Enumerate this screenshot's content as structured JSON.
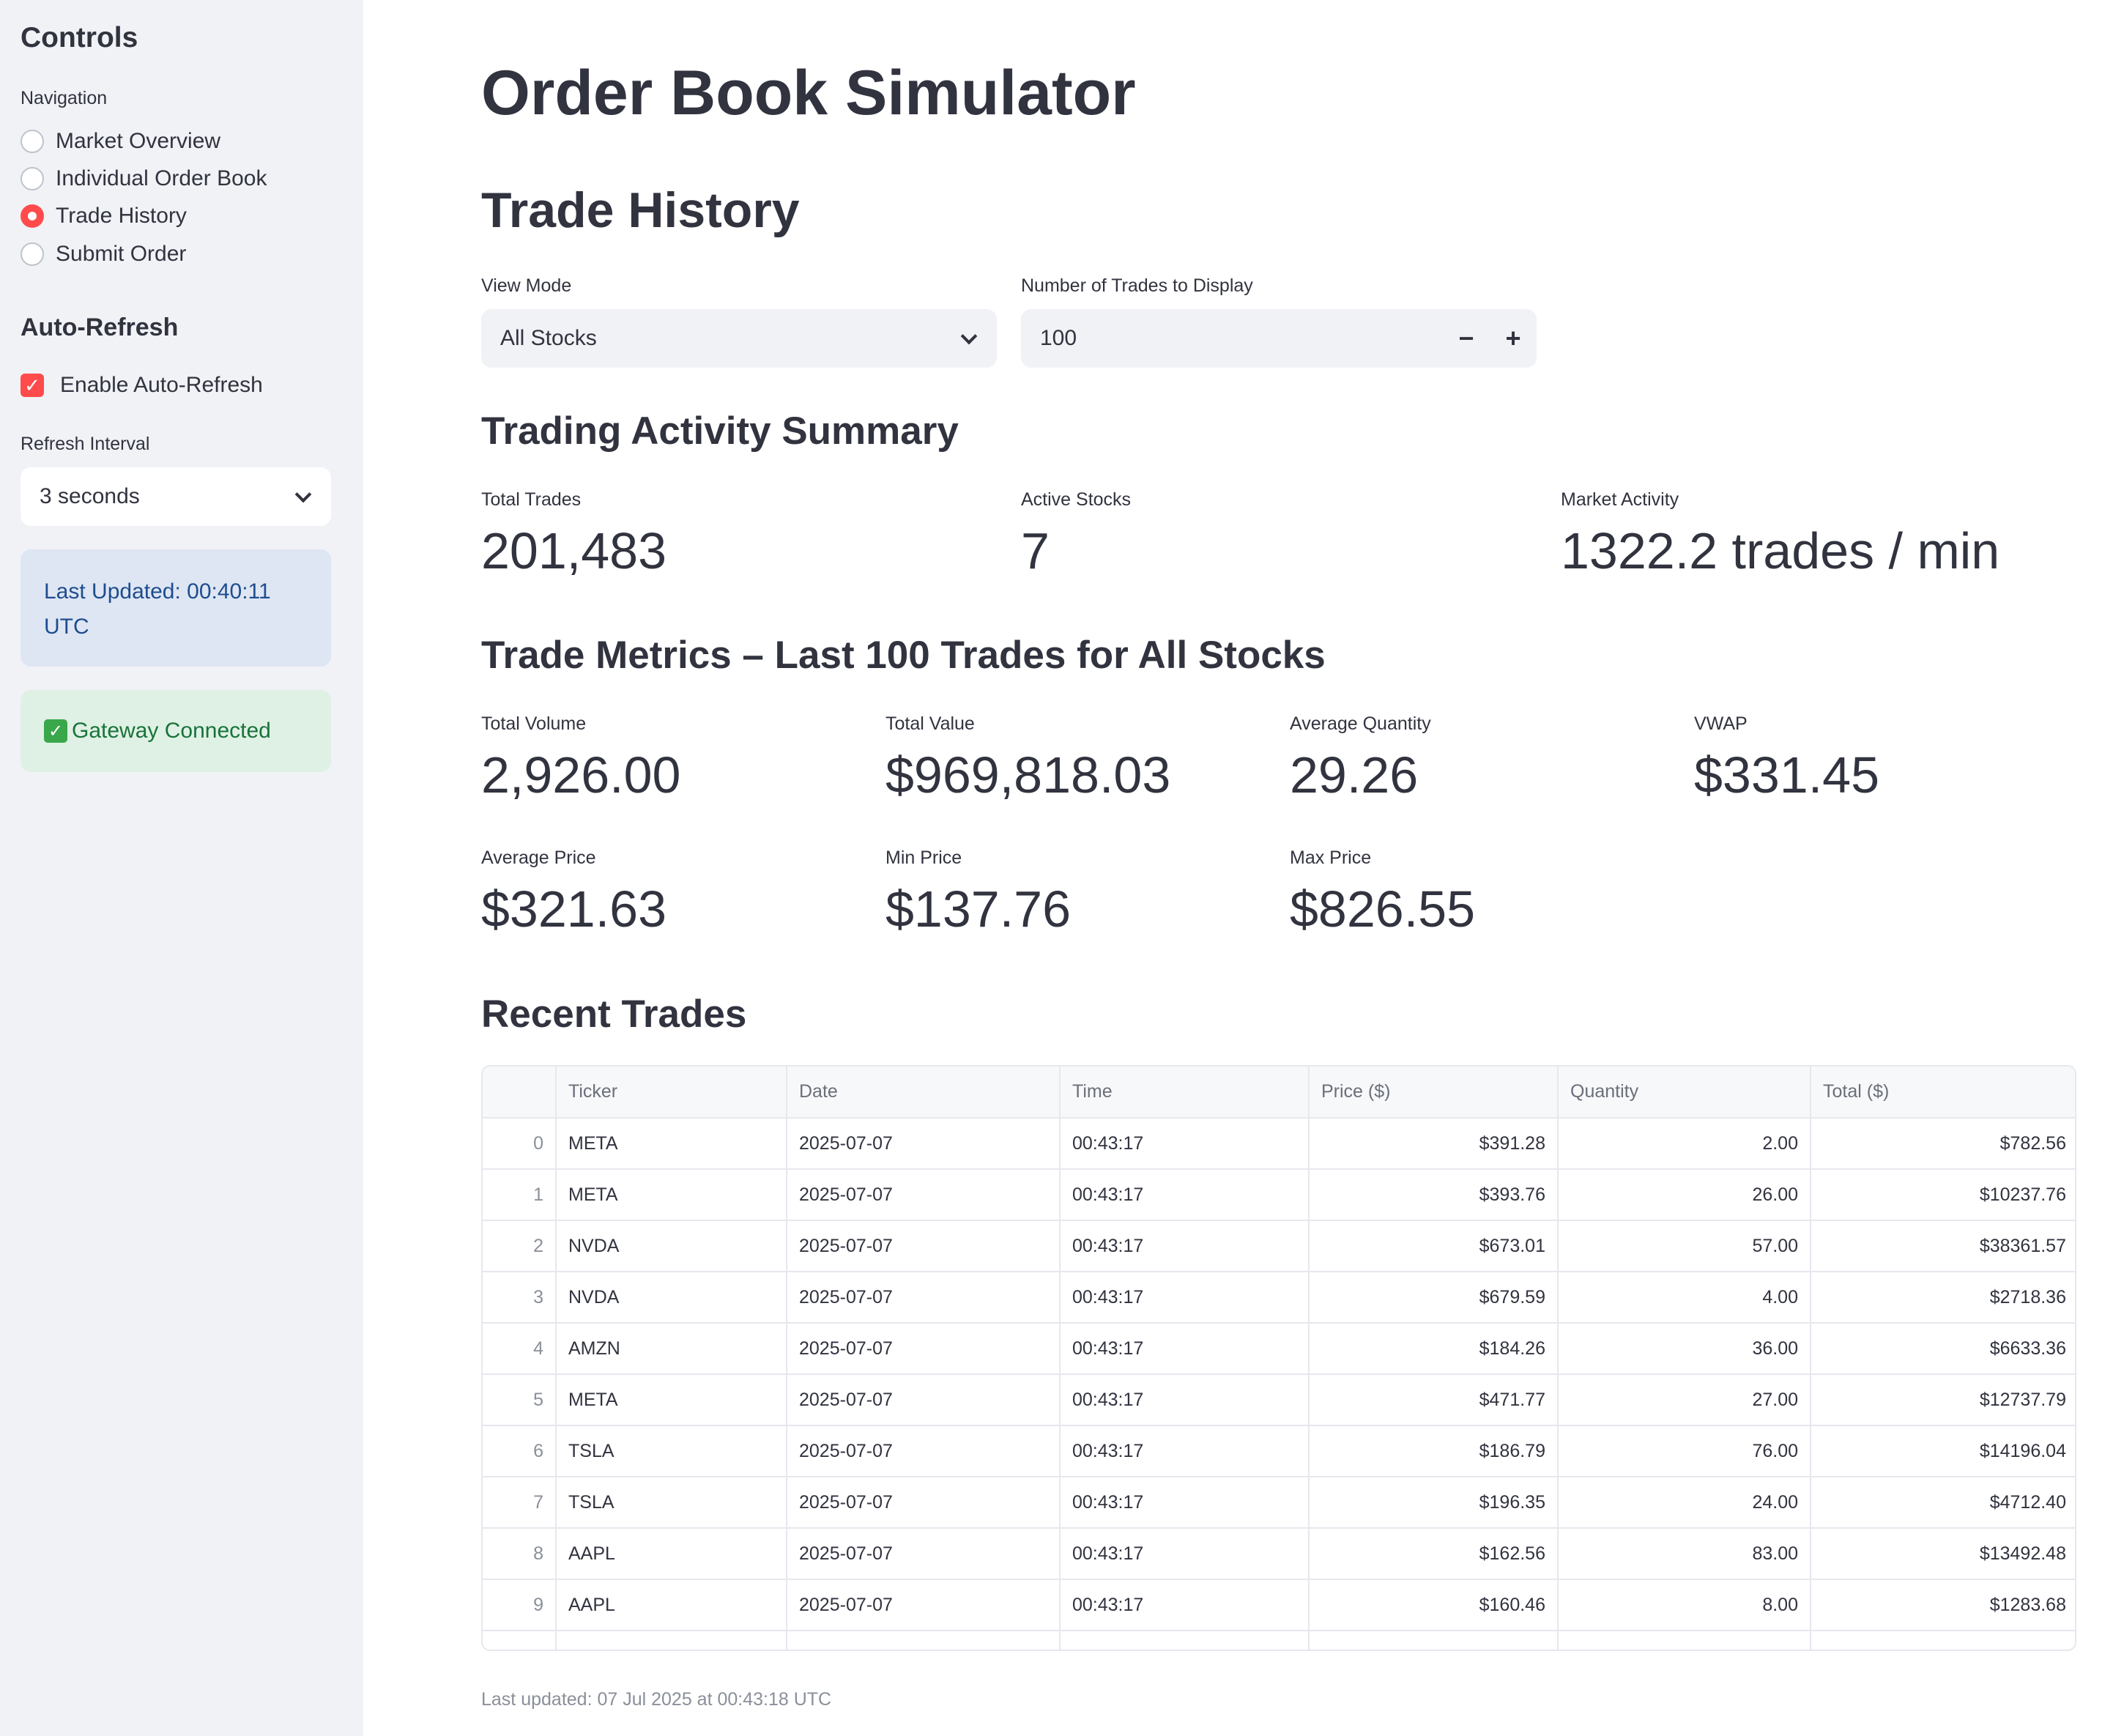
{
  "sidebar": {
    "title": "Controls",
    "navigation_label": "Navigation",
    "nav_items": [
      {
        "label": "Market Overview",
        "selected": false
      },
      {
        "label": "Individual Order Book",
        "selected": false
      },
      {
        "label": "Trade History",
        "selected": true
      },
      {
        "label": "Submit Order",
        "selected": false
      }
    ],
    "auto_refresh_heading": "Auto-Refresh",
    "enable_auto_refresh_label": "Enable Auto-Refresh",
    "enable_auto_refresh_checked": true,
    "refresh_interval_label": "Refresh Interval",
    "refresh_interval_value": "3 seconds",
    "last_updated_text": "Last Updated: 00:40:11 UTC",
    "gateway_status_text": "Gateway Connected"
  },
  "main": {
    "title": "Order Book Simulator",
    "section_title": "Trade History",
    "view_mode_label": "View Mode",
    "view_mode_value": "All Stocks",
    "num_trades_label": "Number of Trades to Display",
    "num_trades_value": "100",
    "summary_heading": "Trading Activity Summary",
    "summary_metrics": [
      {
        "label": "Total Trades",
        "value": "201,483"
      },
      {
        "label": "Active Stocks",
        "value": "7"
      },
      {
        "label": "Market Activity",
        "value": "1322.2 trades / min"
      }
    ],
    "metrics_heading": "Trade Metrics – Last 100 Trades for All Stocks",
    "trade_metrics": [
      {
        "label": "Total Volume",
        "value": "2,926.00"
      },
      {
        "label": "Total Value",
        "value": "$969,818.03"
      },
      {
        "label": "Average Quantity",
        "value": "29.26"
      },
      {
        "label": "VWAP",
        "value": "$331.45"
      },
      {
        "label": "Average Price",
        "value": "$321.63"
      },
      {
        "label": "Min Price",
        "value": "$137.76"
      },
      {
        "label": "Max Price",
        "value": "$826.55"
      }
    ],
    "recent_trades_heading": "Recent Trades",
    "table": {
      "columns": [
        "",
        "Ticker",
        "Date",
        "Time",
        "Price ($)",
        "Quantity",
        "Total ($)"
      ],
      "rows": [
        [
          "0",
          "META",
          "2025-07-07",
          "00:43:17",
          "$391.28",
          "2.00",
          "$782.56"
        ],
        [
          "1",
          "META",
          "2025-07-07",
          "00:43:17",
          "$393.76",
          "26.00",
          "$10237.76"
        ],
        [
          "2",
          "NVDA",
          "2025-07-07",
          "00:43:17",
          "$673.01",
          "57.00",
          "$38361.57"
        ],
        [
          "3",
          "NVDA",
          "2025-07-07",
          "00:43:17",
          "$679.59",
          "4.00",
          "$2718.36"
        ],
        [
          "4",
          "AMZN",
          "2025-07-07",
          "00:43:17",
          "$184.26",
          "36.00",
          "$6633.36"
        ],
        [
          "5",
          "META",
          "2025-07-07",
          "00:43:17",
          "$471.77",
          "27.00",
          "$12737.79"
        ],
        [
          "6",
          "TSLA",
          "2025-07-07",
          "00:43:17",
          "$186.79",
          "76.00",
          "$14196.04"
        ],
        [
          "7",
          "TSLA",
          "2025-07-07",
          "00:43:17",
          "$196.35",
          "24.00",
          "$4712.40"
        ],
        [
          "8",
          "AAPL",
          "2025-07-07",
          "00:43:17",
          "$162.56",
          "83.00",
          "$13492.48"
        ],
        [
          "9",
          "AAPL",
          "2025-07-07",
          "00:43:17",
          "$160.46",
          "8.00",
          "$1283.68"
        ]
      ]
    },
    "footer_text": "Last updated: 07 Jul 2025 at 00:43:18 UTC"
  },
  "colors": {
    "accent": "#ff4b4b",
    "sidebar_bg": "#f0f2f6",
    "info_bg": "#dee6f3",
    "success_bg": "#dff1e5"
  }
}
